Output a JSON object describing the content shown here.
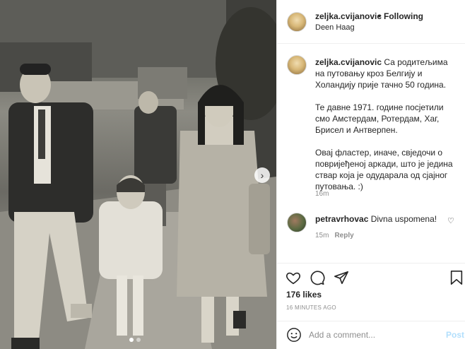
{
  "post": {
    "username": "zeljka.cvijanovic",
    "separator": "•",
    "follow_status": "Following",
    "location": "Deen Haag"
  },
  "caption": {
    "username": "zeljka.cvijanovic",
    "line1": "Са родитељима на путовању кроз Белгију и Холандију прије тачно 50 година.",
    "line2": "Те давне 1971. године посјетили смо Амстердам, Ротердам, Хаг, Брисел и Антверпен.",
    "line3": "Овај фластер, иначе, свједочи о повријеђеној аркади, што је једина ствар која је одударала од сјајног путовања. :)",
    "time": "16m"
  },
  "comment": {
    "username": "petravrhovac",
    "text": "Divna uspomena!",
    "time": "15m",
    "reply_label": "Reply"
  },
  "stats": {
    "likes": "176 likes",
    "posted_ago": "16 MINUTES AGO"
  },
  "add_comment": {
    "placeholder": "Add a comment...",
    "post_label": "Post"
  },
  "icons": {
    "next": "chevron-right-icon",
    "like": "heart-icon",
    "comment": "comment-icon",
    "share": "share-icon",
    "save": "bookmark-icon",
    "emoji": "emoji-icon"
  },
  "colors": {
    "post_button_disabled": "#b2dffc",
    "secondary_text": "#8e8e8e",
    "primary_text": "#262626"
  },
  "carousel": {
    "slides": 2,
    "active_slide": 1
  }
}
